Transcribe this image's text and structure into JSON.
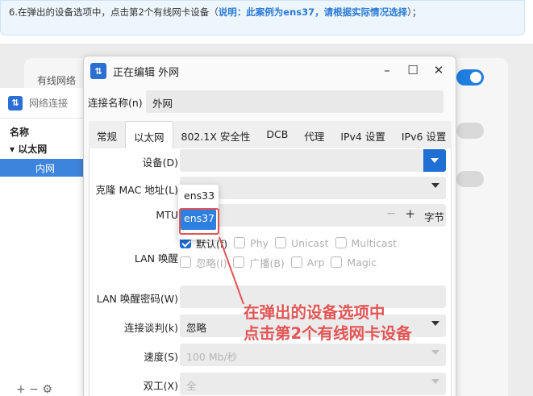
{
  "instruction": {
    "prefix": "6.在弹出的设备选项中，点击第2个有线网卡设备（",
    "highlight": "说明：此案例为ens37，请根据实际情况选择",
    "suffix": "）；"
  },
  "background_settings": {
    "label": "有线网络"
  },
  "network_connections": {
    "title": "网络连接",
    "column_header": "名称",
    "group": "以太网",
    "selected_item": "内网",
    "bottom_controls": "+ − ⚙"
  },
  "dialog": {
    "title": "正在编辑 外网",
    "window_controls": {
      "minimize": "–",
      "maximize": "☐",
      "close": "✕"
    },
    "connection_name_label": "连接名称(n)",
    "connection_name_value": "外网",
    "tabs": [
      "常规",
      "以太网",
      "802.1X 安全性",
      "DCB",
      "代理",
      "IPv4 设置",
      "IPv6 设置"
    ],
    "active_tab": "以太网",
    "fields": {
      "device_label": "设备(D)",
      "device_value": "",
      "clone_mac_label": "克隆 MAC 地址(L)",
      "mtu_label": "MTU",
      "mtu_minus": "−",
      "mtu_plus": "+",
      "mtu_unit": "字节",
      "wol_label": "LAN 唤醒",
      "wol_options_row1": [
        {
          "label": "默认(f)",
          "checked": true
        },
        {
          "label": "Phy",
          "checked": false
        },
        {
          "label": "Unicast",
          "checked": false
        },
        {
          "label": "Multicast",
          "checked": false
        }
      ],
      "wol_options_row2": [
        {
          "label": "忽略(I)",
          "checked": false
        },
        {
          "label": "广播(B)",
          "checked": false
        },
        {
          "label": "Arp",
          "checked": false
        },
        {
          "label": "Magic",
          "checked": false
        }
      ],
      "wol_password_label": "LAN 唤醒密码(W)",
      "negotiation_label": "连接谈判(k)",
      "negotiation_value": "忽略",
      "speed_label": "速度(S)",
      "speed_value": "100 Mb/秒",
      "duplex_label": "双工(X)",
      "duplex_value": "全"
    },
    "device_dropdown": {
      "options": [
        "ens33",
        "ens37"
      ],
      "selected": "ens37"
    }
  },
  "annotation": {
    "line1": "在弹出的设备选项中",
    "line2": "点击第2个有线网卡设备"
  },
  "colors": {
    "accent": "#1f6fd4",
    "annotation": "#e35454",
    "selection": "#2f7fe0"
  }
}
